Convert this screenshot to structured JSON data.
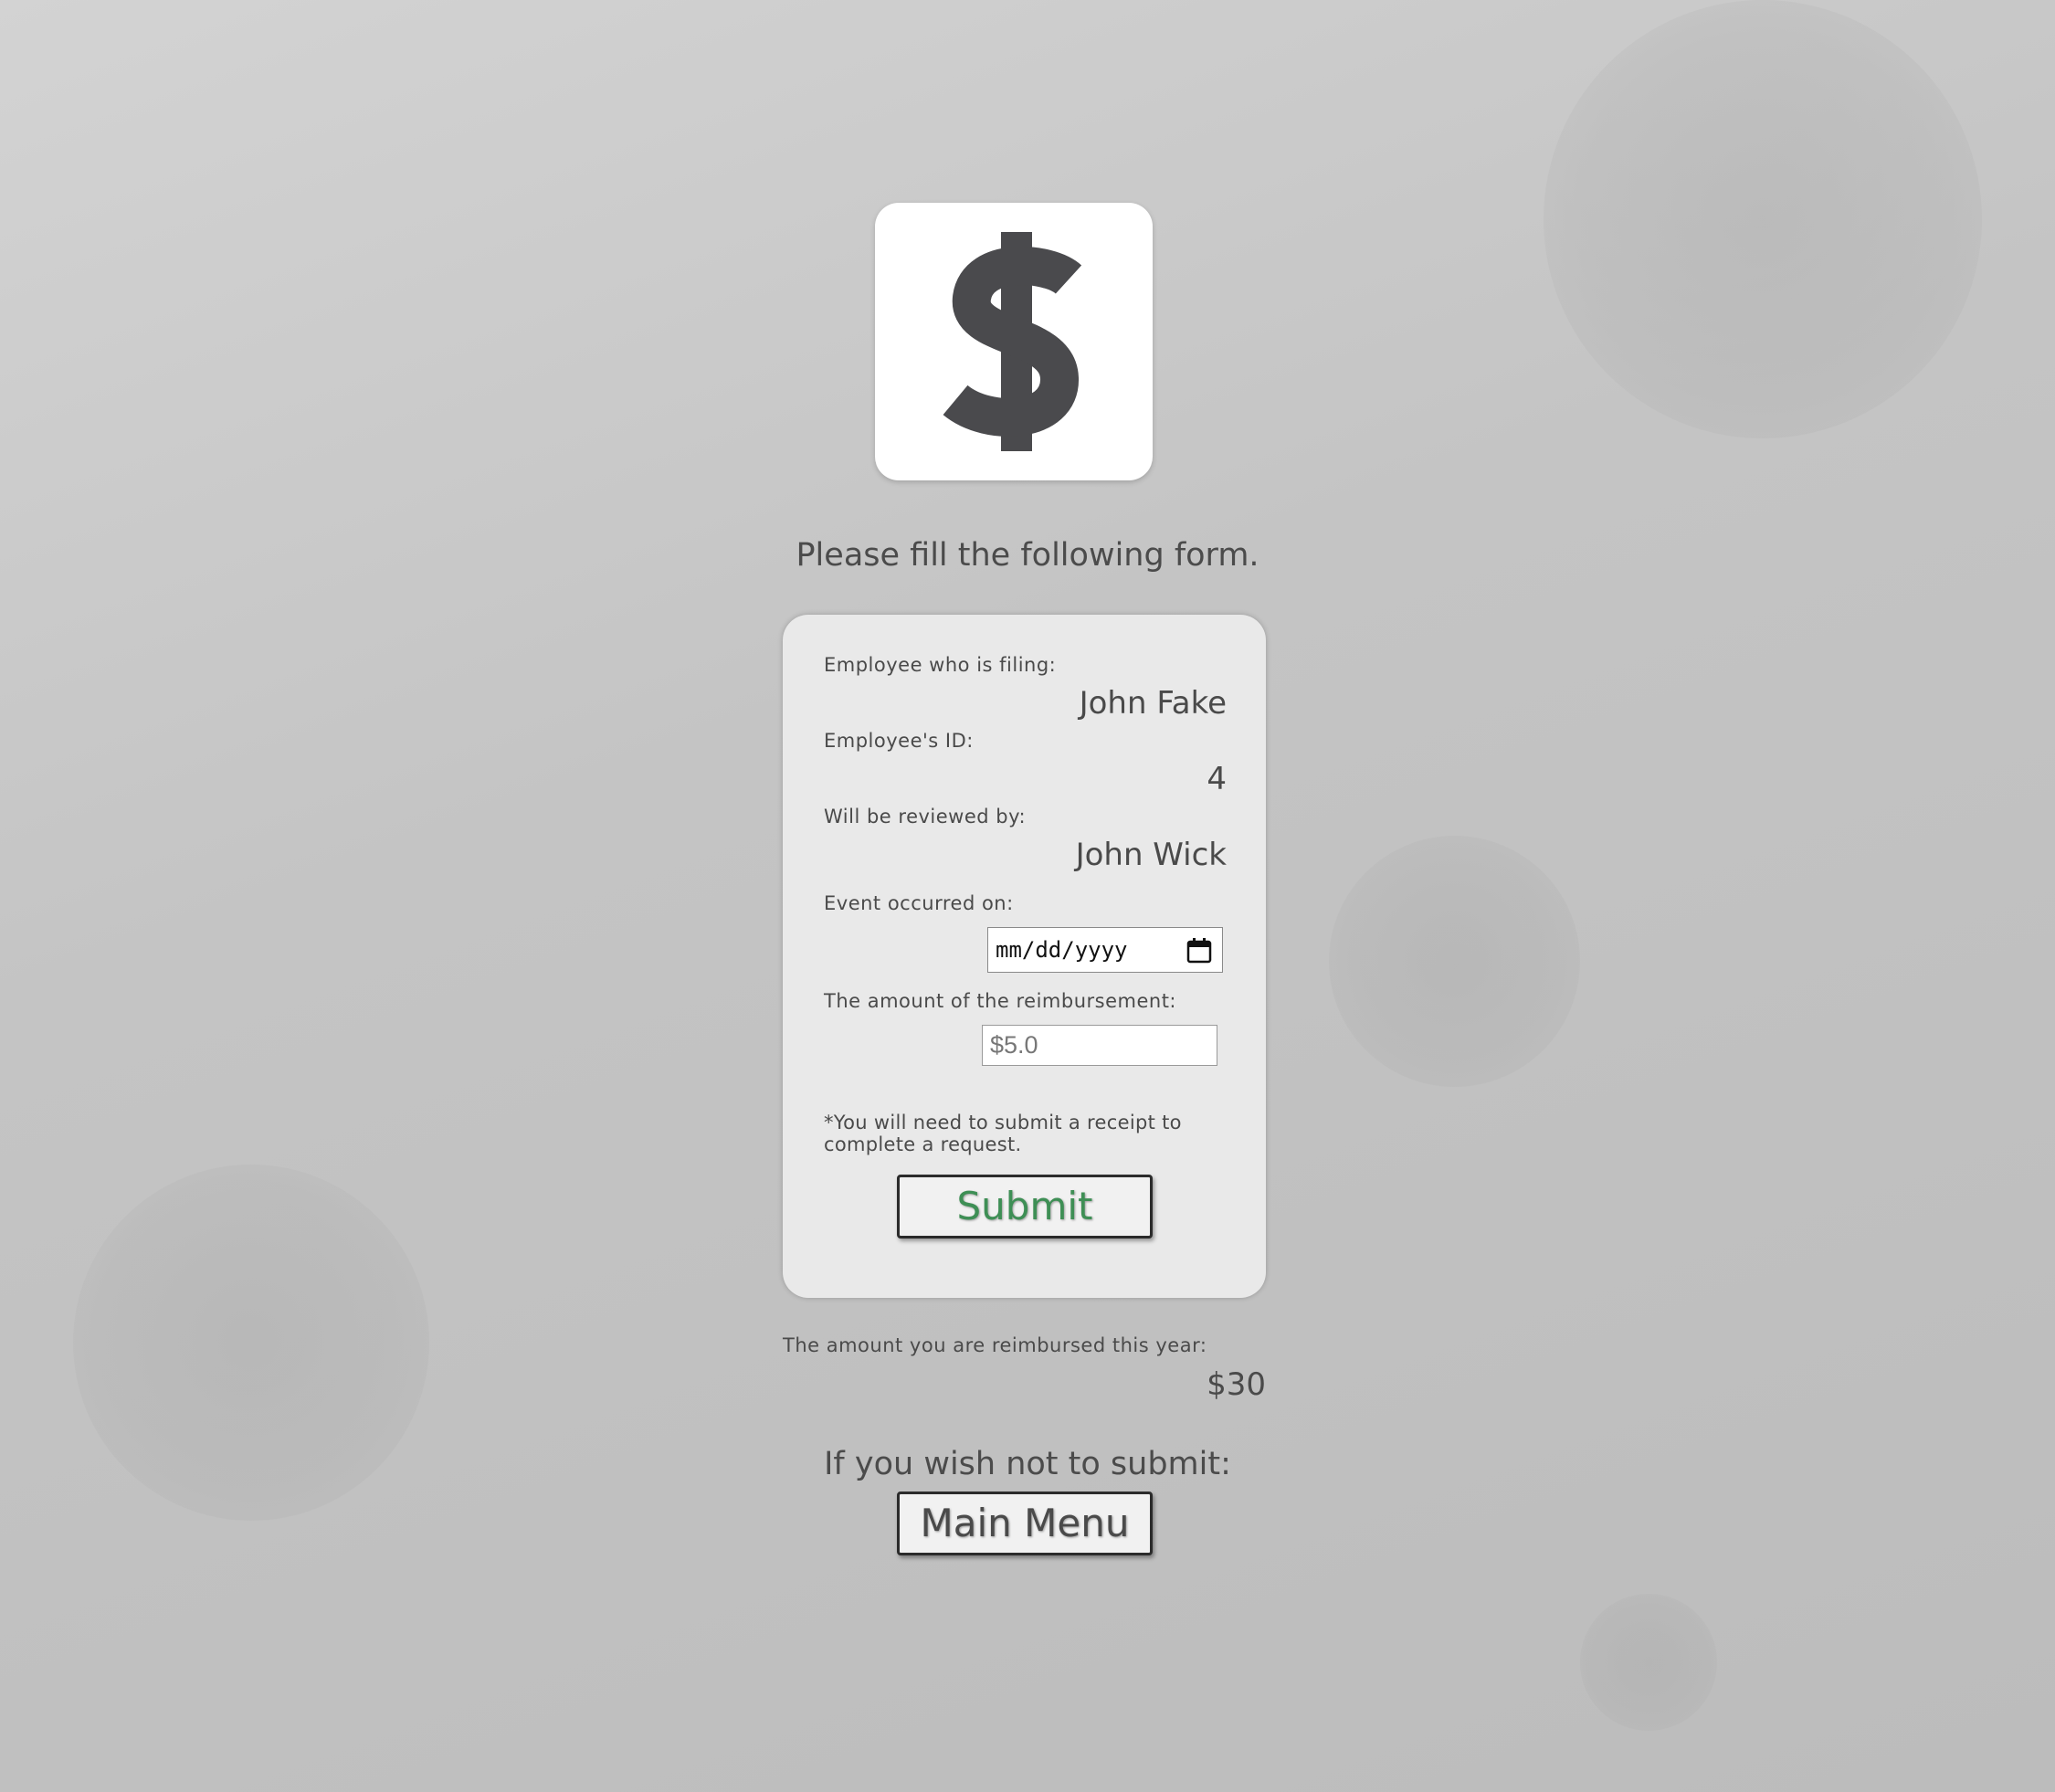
{
  "intro_text": "Please fill the following form.",
  "form": {
    "employee_label": "Employee who is filing:",
    "employee_name": "John Fake",
    "id_label": "Employee's ID:",
    "id_value": "4",
    "reviewer_label": "Will be reviewed by:",
    "reviewer_name": "John Wick",
    "date_label": "Event occurred on:",
    "date_placeholder": "mm/dd/yyyy",
    "amount_label": "The amount of the reimbursement:",
    "amount_placeholder": "$5.0",
    "receipt_note": "*You will need to submit a receipt to complete a request.",
    "submit_label": "Submit"
  },
  "reimbursed": {
    "label": "The amount you are reimbursed this year:",
    "value": "$30"
  },
  "exit": {
    "prompt": "If you wish not to submit:",
    "menu_label": "Main Menu"
  },
  "colors": {
    "submit_text": "#3e8f55",
    "background": "#c4c4c4",
    "card": "#e9e9e9"
  },
  "icons": {
    "logo": "dollar-sign-icon",
    "calendar": "calendar-icon"
  }
}
